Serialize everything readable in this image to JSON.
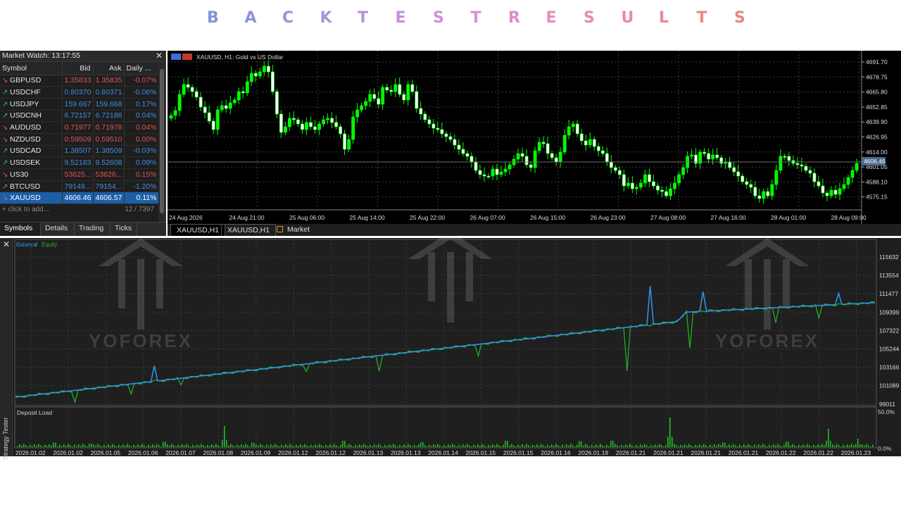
{
  "banner": {
    "letters": [
      "B",
      "A",
      "C",
      "K",
      "T",
      "E",
      "S",
      "T",
      "R",
      "E",
      "S",
      "U",
      "L",
      "T",
      "S"
    ],
    "colors": [
      "#7f95d6",
      "#8c94d8",
      "#9a93da",
      "#a892db",
      "#b791dc",
      "#c491dc",
      "#d090d9",
      "#d88fd2",
      "#de8ec8",
      "#e28dbc",
      "#e58cb0",
      "#e78ba3",
      "#e88a95",
      "#e88987",
      "#e8887a"
    ]
  },
  "market_watch": {
    "title": "Market Watch: 13:17:55",
    "columns": [
      "Symbol",
      "Bid",
      "Ask",
      "Daily ..."
    ],
    "rows": [
      {
        "dir": "down",
        "symbol": "GBPUSD",
        "bid": "1.35833",
        "ask": "1.35835",
        "daily": "-0.07%"
      },
      {
        "dir": "up",
        "symbol": "USDCHF",
        "bid": "0.80370",
        "ask": "0.80371",
        "daily": "-0.06%"
      },
      {
        "dir": "up",
        "symbol": "USDJPY",
        "bid": "159.667",
        "ask": "159.668",
        "daily": "0.17%"
      },
      {
        "dir": "up",
        "symbol": "USDCNH",
        "bid": "6.72157",
        "ask": "6.72186",
        "daily": "0.04%"
      },
      {
        "dir": "down",
        "symbol": "AUDUSD",
        "bid": "0.71977",
        "ask": "0.71978",
        "daily": "0.04%"
      },
      {
        "dir": "down",
        "symbol": "NZDUSD",
        "bid": "0.59509",
        "ask": "0.59510",
        "daily": "0.00%"
      },
      {
        "dir": "up",
        "symbol": "USDCAD",
        "bid": "1.38507",
        "ask": "1.38509",
        "daily": "-0.03%"
      },
      {
        "dir": "up",
        "symbol": "USDSEK",
        "bid": "9.52183",
        "ask": "9.52608",
        "daily": "0.09%"
      },
      {
        "dir": "down",
        "symbol": "US30",
        "bid": "53625...",
        "ask": "53626...",
        "daily": "0.15%"
      },
      {
        "dir": "up",
        "symbol": "BTCUSD",
        "bid": "79149...",
        "ask": "79154...",
        "daily": "-1.20%"
      },
      {
        "dir": "down",
        "symbol": "XAUUSD",
        "bid": "4606.46",
        "ask": "4606.57",
        "daily": "0.11%",
        "selected": true
      }
    ],
    "add_label": "click to add...",
    "count": "12 / 7397",
    "tabs": [
      "Symbols",
      "Details",
      "Trading",
      "Ticks"
    ]
  },
  "price_chart": {
    "title": "XAUUSD, H1:  Gold vs US Dollar",
    "price_labels": [
      "4691.70",
      "4678.75",
      "4665.80",
      "4652.85",
      "4639.90",
      "4626.95",
      "4614.00",
      "4601.05",
      "4588.10",
      "4575.15"
    ],
    "current_price": "4606.46",
    "time_labels": [
      "24 Aug 2026",
      "24 Aug 21:00",
      "25 Aug 06:00",
      "25 Aug 14:00",
      "25 Aug 22:00",
      "26 Aug 07:00",
      "26 Aug 15:00",
      "26 Aug 23:00",
      "27 Aug 08:00",
      "27 Aug 16:00",
      "28 Aug 01:00",
      "28 Aug 09:00"
    ],
    "tabs": [
      "XAUUSD,H1",
      "XAUUSD,H1",
      "Market"
    ]
  },
  "tester": {
    "legend_balance": "Balance",
    "legend_sep": " / ",
    "legend_equity": "Equity",
    "y_labels": [
      "115632",
      "113554",
      "111477",
      "109399",
      "107322",
      "105244",
      "103166",
      "101089",
      "99011"
    ],
    "load_title": "Deposit Load",
    "load_labels": [
      "50.0%",
      "0.0%"
    ],
    "date_labels": [
      "2026.01.02",
      "2026.01.02",
      "2026.01.05",
      "2026.01.06",
      "2026.01.07",
      "2026.01.08",
      "2026.01.09",
      "2026.01.12",
      "2026.01.12",
      "2026.01.13",
      "2026.01.13",
      "2026.01.14",
      "2026.01.15",
      "2026.01.15",
      "2026.01.16",
      "2026.01.19",
      "2026.01.21",
      "2026.01.21",
      "2026.01.21",
      "2026.01.21",
      "2026.01.22",
      "2026.01.22",
      "2026.01.23"
    ],
    "side_label": "Strategy Tester",
    "watermark": "YOFOREX"
  },
  "colors": {
    "bull": "#00ff00",
    "bear": "#ffffff",
    "balance": "#2f8fe8",
    "equity": "#22b822",
    "grid": "#3a3a3a"
  }
}
